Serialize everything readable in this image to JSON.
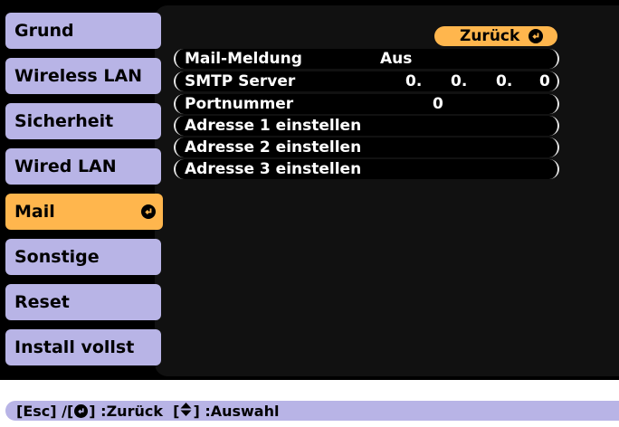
{
  "sidebar": {
    "items": [
      {
        "label": "Grund"
      },
      {
        "label": "Wireless LAN"
      },
      {
        "label": "Sicherheit"
      },
      {
        "label": "Wired LAN"
      },
      {
        "label": "Mail",
        "selected": true
      },
      {
        "label": "Sonstige"
      },
      {
        "label": "Reset"
      },
      {
        "label": "Install vollst"
      }
    ]
  },
  "back_button": {
    "label": "Zurück",
    "icon": "enter-icon"
  },
  "settings": {
    "mail_notification": {
      "label": "Mail-Meldung",
      "value": "Aus"
    },
    "smtp_server": {
      "label": "SMTP Server",
      "octets": [
        "0.",
        "0.",
        "0.",
        "0"
      ]
    },
    "port_number": {
      "label": "Portnummer",
      "value": "0"
    },
    "address1": {
      "label": "Adresse 1 einstellen"
    },
    "address2": {
      "label": "Adresse 2 einstellen"
    },
    "address3": {
      "label": "Adresse 3 einstellen"
    }
  },
  "statusbar": {
    "esc": "[Esc] /[",
    "back_sep": "] :Zurück  [",
    "select_sep": "] :Auswahl",
    "enter_icon": "enter-icon",
    "updown_icon": "up-down-arrow-icon"
  },
  "colors": {
    "menu_item": "#b8b4e6",
    "selected": "#ffb64d",
    "background": "#000000"
  }
}
